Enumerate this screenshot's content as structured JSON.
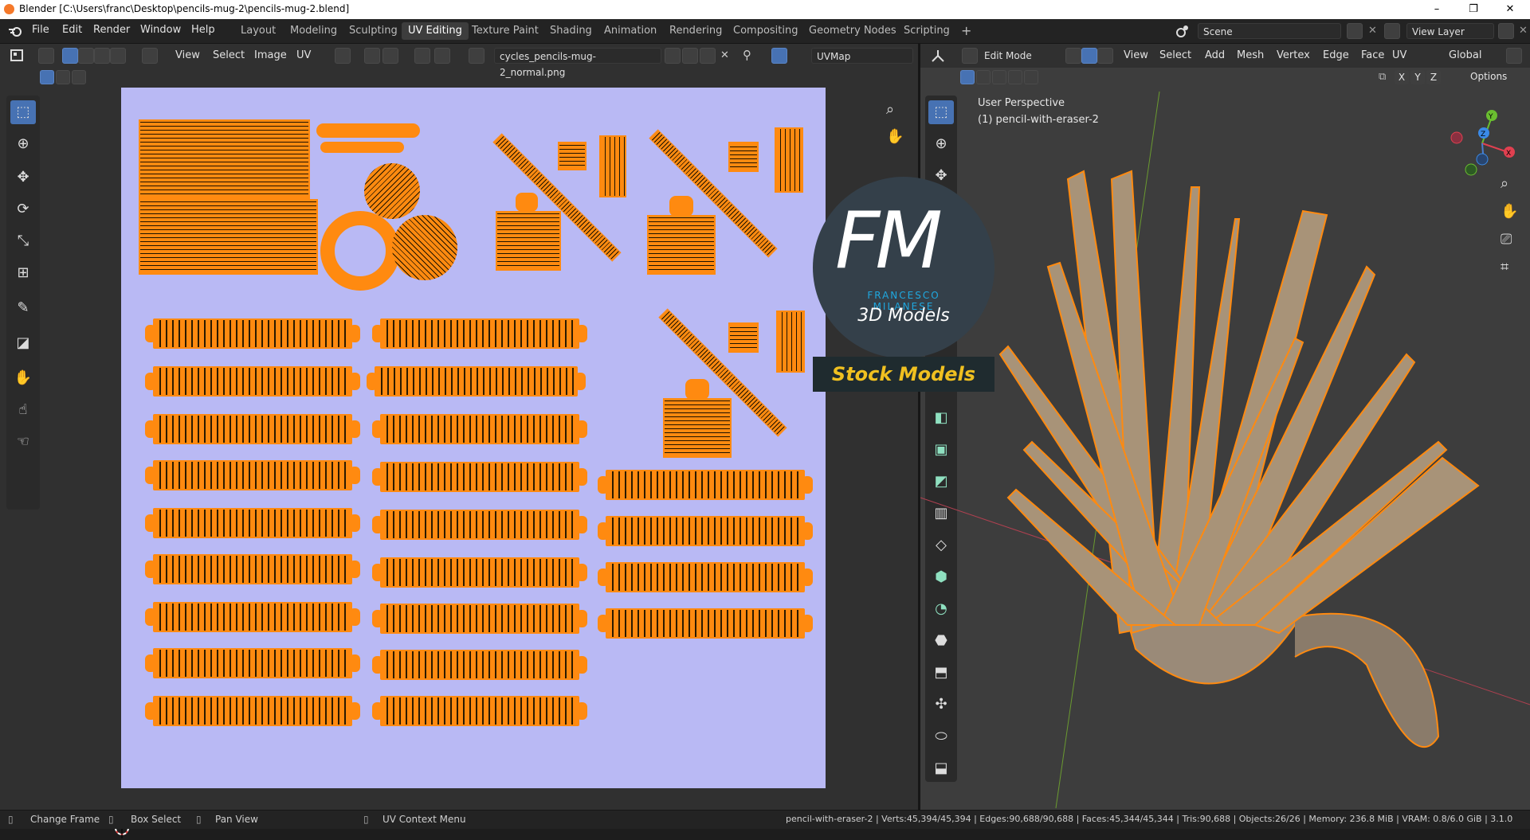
{
  "window": {
    "title": "Blender [C:\\Users\\franc\\Desktop\\pencils-mug-2\\pencils-mug-2.blend]",
    "controls": [
      "–",
      "❐",
      "✕"
    ]
  },
  "menubar": {
    "items": [
      "File",
      "Edit",
      "Render",
      "Window",
      "Help"
    ]
  },
  "workspaces": {
    "tabs": [
      "Layout",
      "Modeling",
      "Sculpting",
      "UV Editing",
      "Texture Paint",
      "Shading",
      "Animation",
      "Rendering",
      "Compositing",
      "Geometry Nodes",
      "Scripting"
    ],
    "active": "UV Editing",
    "add": "+"
  },
  "scene": {
    "name": "Scene",
    "view_layer": "View Layer"
  },
  "uv_editor": {
    "menus": [
      "View",
      "Select",
      "Image",
      "UV"
    ],
    "image_name": "cycles_pencils-mug-2_normal.png",
    "uvmap": "UVMap"
  },
  "viewport": {
    "mode": "Edit Mode",
    "menus": [
      "View",
      "Select",
      "Add",
      "Mesh",
      "Vertex",
      "Edge",
      "Face",
      "UV"
    ],
    "orientation": "Global",
    "axes": [
      "X",
      "Y",
      "Z"
    ],
    "options_label": "Options",
    "perspective_label": "User Perspective",
    "object_label": "(1) pencil-with-eraser-2",
    "gizmo_labels": {
      "y": "Y",
      "z": "Z",
      "x": "X"
    }
  },
  "watermark": {
    "logo": "FM",
    "name": "FRANCESCO MILANESE",
    "subtitle": "3D Models",
    "banner": "Stock Models"
  },
  "statusbar": {
    "change_frame": "Change Frame",
    "box_select": "Box Select",
    "pan_view": "Pan View",
    "uv_context": "UV Context Menu",
    "stats": "pencil-with-eraser-2 | Verts:45,394/45,394 | Edges:90,688/90,688 | Faces:45,344/45,344 | Tris:90,688 | Objects:26/26 | Memory: 236.8 MiB | VRAM: 0.8/6.0 GiB | 3.1.0"
  },
  "colors": {
    "accent": "#4772b3",
    "uv_orange": "#ff8a10",
    "image_bg": "#b9b9f4",
    "watermark_cyan": "#1fa8e0",
    "banner_text": "#f0c020"
  }
}
